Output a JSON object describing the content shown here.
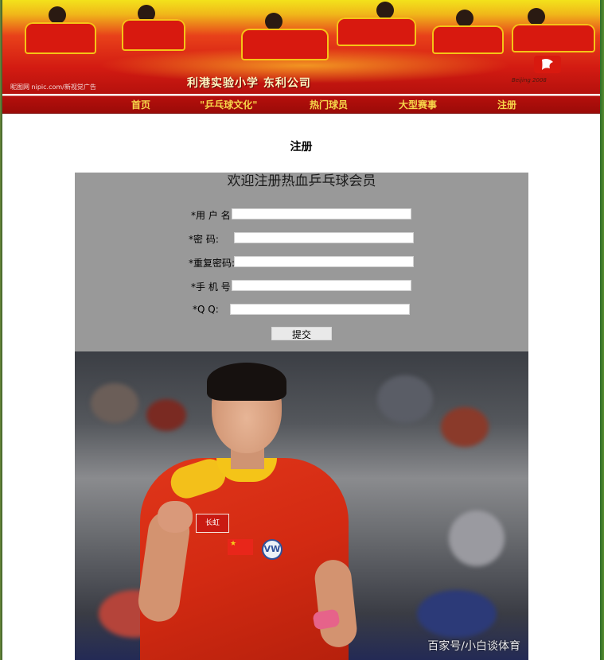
{
  "banner": {
    "caption": "利港实验小学    东利公司",
    "watermark": "昵图网 nipic.com/新视觉广告",
    "emblem_label": "Beijing 2008"
  },
  "nav": {
    "items": [
      {
        "label": "首页"
      },
      {
        "label": "\"乒乓球文化\""
      },
      {
        "label": "热门球员"
      },
      {
        "label": "大型赛事"
      },
      {
        "label": "注册"
      }
    ]
  },
  "page_title": "注册",
  "form": {
    "welcome": "欢迎注册热血乒乓球会员",
    "fields": [
      {
        "label": "*用 户 名",
        "value": ""
      },
      {
        "label": "*密    码:",
        "value": ""
      },
      {
        "label": "*重复密码:",
        "value": ""
      },
      {
        "label": "*手 机 号",
        "value": ""
      },
      {
        "label": "*Q     Q:",
        "value": ""
      }
    ],
    "submit_label": "提交"
  },
  "photo": {
    "watermark": "百家号/小白谈体育",
    "shirt_badge": "长虹",
    "logo_text": "VW"
  },
  "colors": {
    "nav_text": "#f7d64a",
    "nav_bg": "#9b0b08",
    "panel_bg": "#999999"
  }
}
